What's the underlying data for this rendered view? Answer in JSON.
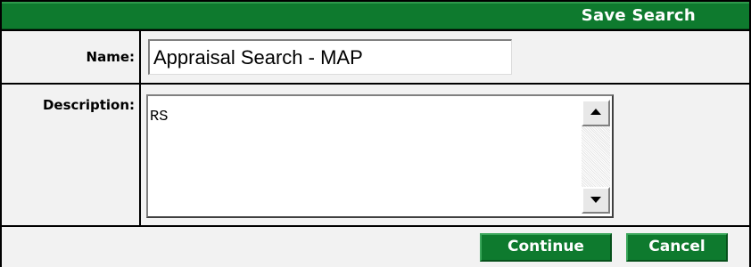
{
  "dialog": {
    "title": "Save Search"
  },
  "form": {
    "name_label": "Name:",
    "name_value": "Appraisal Search - MAP",
    "description_label": "Description:",
    "description_value": "RS"
  },
  "actions": {
    "continue_label": "Continue",
    "cancel_label": "Cancel"
  },
  "colors": {
    "header_green": "#0e7a2e",
    "label_background": "#f2f2f2",
    "border": "#000000"
  },
  "icons": {
    "scroll_up": "arrow-up-icon",
    "scroll_down": "arrow-down-icon"
  }
}
